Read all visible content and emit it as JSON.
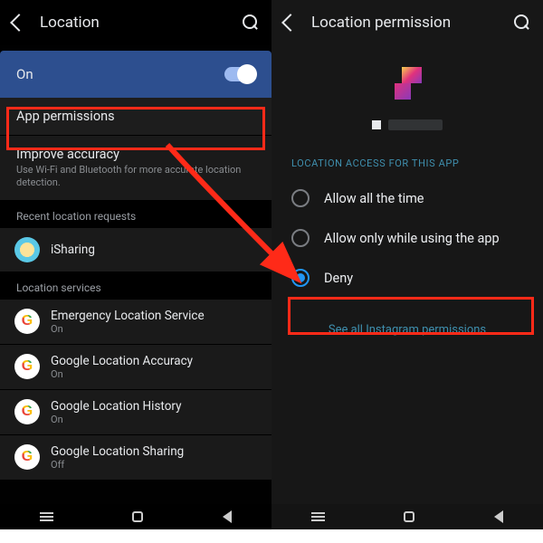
{
  "left": {
    "title": "Location",
    "toggle": {
      "label": "On",
      "enabled": true
    },
    "appPermissions": "App permissions",
    "improve": {
      "title": "Improve accuracy",
      "desc": "Use Wi-Fi and Bluetooth for more accurate location detection."
    },
    "recentHeader": "Recent location requests",
    "recent": [
      {
        "name": "iSharing"
      }
    ],
    "servicesHeader": "Location services",
    "services": [
      {
        "name": "Emergency Location Service",
        "status": "On"
      },
      {
        "name": "Google Location Accuracy",
        "status": "On"
      },
      {
        "name": "Google Location History",
        "status": "On"
      },
      {
        "name": "Google Location Sharing",
        "status": "Off"
      }
    ]
  },
  "right": {
    "title": "Location permission",
    "section": "LOCATION ACCESS FOR THIS APP",
    "options": [
      {
        "label": "Allow all the time",
        "selected": false
      },
      {
        "label": "Allow only while using the app",
        "selected": false
      },
      {
        "label": "Deny",
        "selected": true
      }
    ],
    "seeAll": "See all Instagram permissions"
  }
}
